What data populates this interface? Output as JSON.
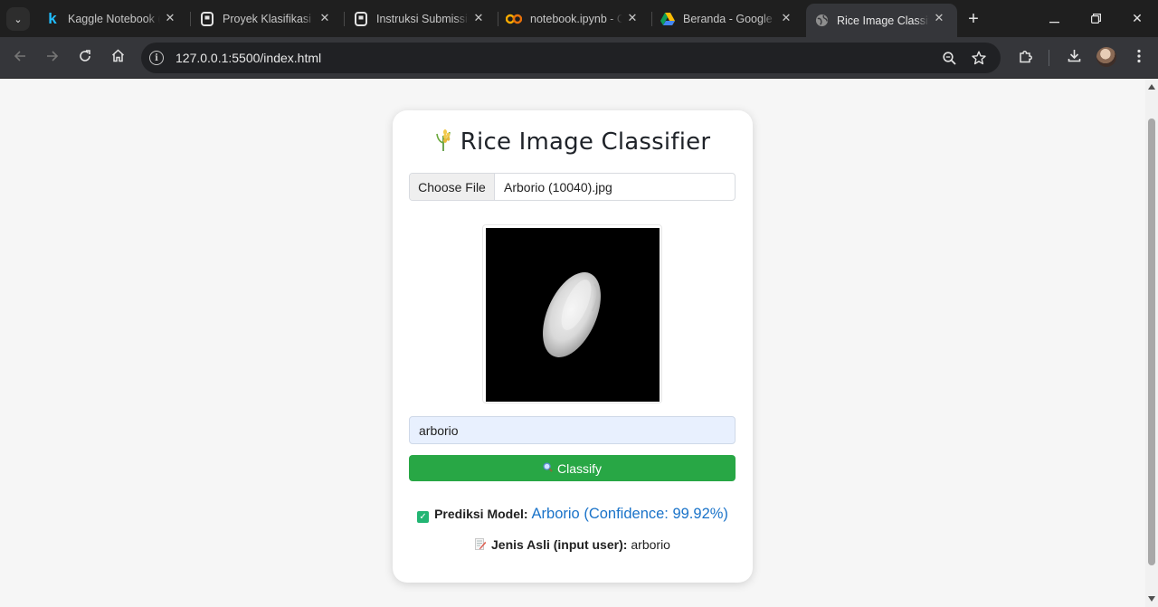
{
  "browser": {
    "tabs": [
      {
        "title": "Kaggle Notebook (",
        "favicon": "kaggle-icon"
      },
      {
        "title": "Proyek Klasifikasi G",
        "favicon": "dicoding-icon"
      },
      {
        "title": "Instruksi Submissio",
        "favicon": "dicoding-icon"
      },
      {
        "title": "notebook.ipynb - C",
        "favicon": "colab-icon"
      },
      {
        "title": "Beranda - Google D",
        "favicon": "google-drive-icon"
      },
      {
        "title": "Rice Image Classifie",
        "favicon": "globe-icon",
        "active": true
      }
    ],
    "url": "127.0.0.1:5500/index.html"
  },
  "page": {
    "title": "Rice Image Classifier",
    "title_icon": "rice-icon",
    "file_button_label": "Choose File",
    "file_name": "Arborio (10040).jpg",
    "preview_alt": "rice-grain-image",
    "type_input_value": "arborio",
    "classify_label": "Classify",
    "classify_icon": "magnifier-icon",
    "prediction_label": "Prediksi Model:",
    "prediction_value": "Arborio (Confidence: 99.92%)",
    "actual_label": "Jenis Asli (input user):",
    "actual_value": "arborio",
    "colors": {
      "classify_button": "#28a745",
      "prediction_text": "#1a73c9",
      "check_badge": "#22b573"
    }
  }
}
